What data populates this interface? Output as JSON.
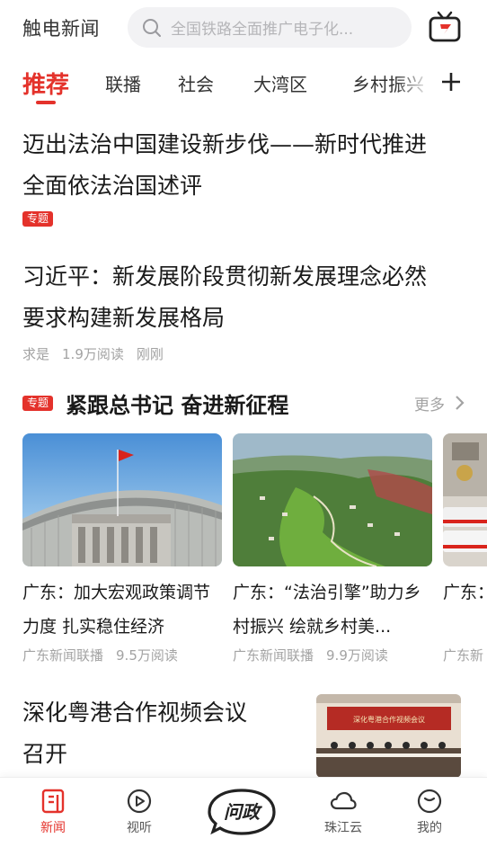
{
  "header": {
    "app_title": "触电新闻",
    "search_placeholder": "全国铁路全面推广电子化..."
  },
  "tabs": [
    {
      "label": "推荐",
      "active": true
    },
    {
      "label": "联播"
    },
    {
      "label": "社会"
    },
    {
      "label": "大湾区"
    },
    {
      "label": "乡村振兴"
    }
  ],
  "articles": [
    {
      "title_line1": "迈出法治中国建设新步伐——新时代推进",
      "title_line2": "全面依法治国述评",
      "tag": "专题"
    },
    {
      "title_line1": "习近平：新发展阶段贯彻新发展理念必然",
      "title_line2": "要求构建新发展格局",
      "source": "求是",
      "reads": "1.9万阅读",
      "time": "刚刚"
    }
  ],
  "topic": {
    "tag": "专题",
    "title": "紧跟总书记 奋进新征程",
    "more": "更多",
    "cards": [
      {
        "title": "广东：加大宏观政策调节力度 扎实稳住经济",
        "source": "广东新闻联播",
        "reads": "9.5万阅读"
      },
      {
        "title": "广东：“法治引擎”助力乡村振兴 绘就乡村美...",
        "source": "广东新闻联播",
        "reads": "9.9万阅读"
      },
      {
        "title": "广东：输方式",
        "source": "广东新",
        "reads": ""
      }
    ]
  },
  "last_article": {
    "title_line1": "深化粤港合作视频会议",
    "title_line2": "召开",
    "thumb_caption": "深化粤港合作视频会议"
  },
  "bottom_nav": [
    {
      "label": "新闻",
      "icon": "news-icon",
      "active": true
    },
    {
      "label": "视听",
      "icon": "play-icon"
    },
    {
      "label": "问政",
      "icon": "wenzheng-logo"
    },
    {
      "label": "珠江云",
      "icon": "cloud-icon"
    },
    {
      "label": "我的",
      "icon": "profile-icon"
    }
  ],
  "colors": {
    "accent": "#e4322b",
    "muted": "#a3a3a3"
  }
}
